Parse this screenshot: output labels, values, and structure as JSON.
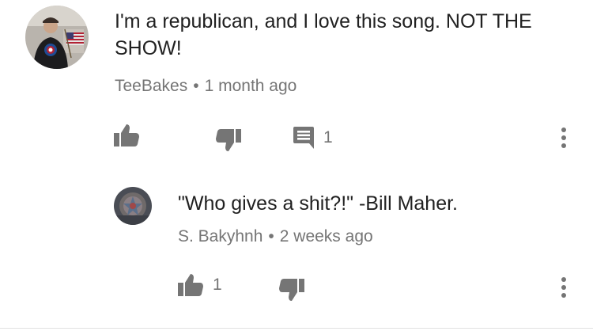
{
  "comment": {
    "text": "I'm a republican, and I love this song. NOT THE SHOW!",
    "author": "TeeBakes",
    "separator": "•",
    "time": "1 month ago",
    "reply_count": "1",
    "avatar_icon": "user-avatar"
  },
  "reply": {
    "text": "\"Who gives a shit?!\" -Bill Maher.",
    "author": "S. Bakyhnh",
    "separator": "•",
    "time": "2 weeks ago",
    "like_count": "1",
    "avatar_icon": "user-avatar"
  },
  "icons": {
    "like": "thumbs-up-icon",
    "dislike": "thumbs-down-icon",
    "reply": "comment-icon",
    "more": "more-vert-icon"
  },
  "colors": {
    "text": "#212121",
    "secondary": "#757575",
    "background": "#ffffff"
  }
}
